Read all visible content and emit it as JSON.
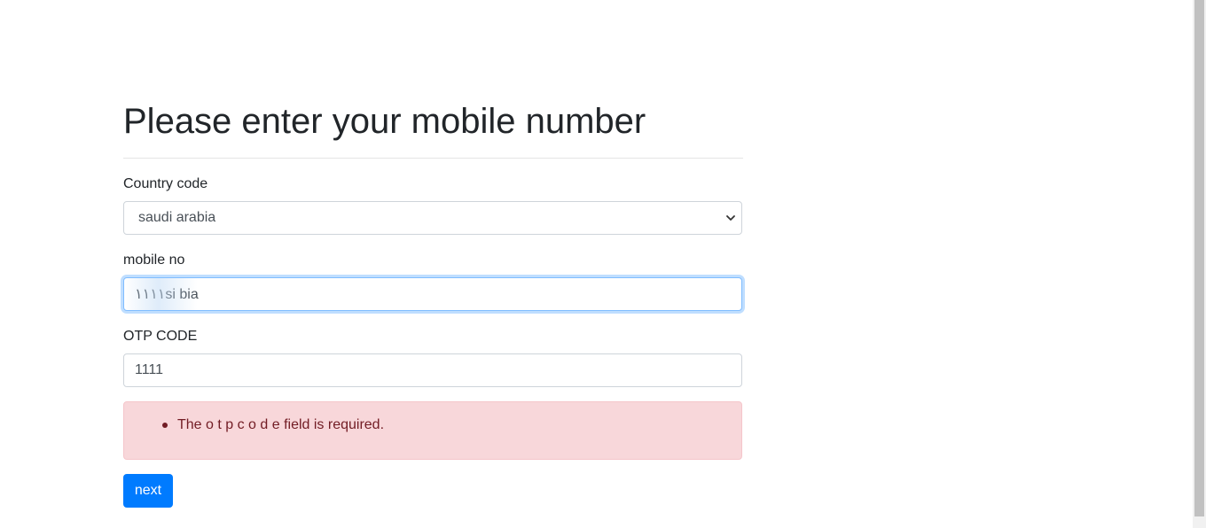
{
  "page": {
    "title": "Please enter your mobile number"
  },
  "form": {
    "country": {
      "label": "Country code",
      "selected": "saudi arabia"
    },
    "mobile": {
      "label": "mobile no",
      "value": "١١١١si bia"
    },
    "otp": {
      "label": "OTP CODE",
      "value": "1111"
    },
    "errors": [
      "The o t p c o d e field is required."
    ],
    "submit_label": "next"
  },
  "colors": {
    "primary": "#007bff",
    "alert_bg": "#f8d7da",
    "alert_text": "#721c24",
    "focus_border": "#80bdff"
  }
}
